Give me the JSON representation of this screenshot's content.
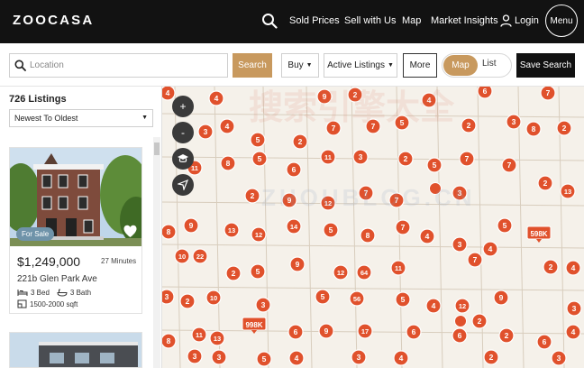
{
  "brand": {
    "logo": "ZOOCASA"
  },
  "nav": {
    "links": [
      "Sold Prices",
      "Sell with Us",
      "Map",
      "Market Insights"
    ],
    "login": "Login",
    "menu": "Menu"
  },
  "filters": {
    "location_placeholder": "Location",
    "search_label": "Search",
    "buy_label": "Buy",
    "status_label": "Active Listings",
    "more_label": "More",
    "map_label": "Map",
    "list_label": "List",
    "save_search_label": "Save Search"
  },
  "listings": {
    "count": "726 Listings",
    "sort": "Newest To Oldest",
    "card": {
      "badge": "For Sale",
      "price": "$1,249,000",
      "time": "27 Minutes",
      "address": "221b Glen Park Ave",
      "beds": "3 Bed",
      "baths": "3 Bath",
      "sqft": "1500-2000 sqft"
    }
  },
  "map": {
    "accent_color": "#e0512c",
    "grid_color": "#d8cdbd",
    "controls": [
      "zoom-in",
      "zoom-out",
      "school",
      "locate"
    ],
    "markers": [
      {
        "label": "4",
        "kind": "circle"
      },
      {
        "label": "4",
        "kind": "circle"
      },
      {
        "label": "9",
        "kind": "circle"
      },
      {
        "label": "2",
        "kind": "circle"
      },
      {
        "label": "4",
        "kind": "circle"
      },
      {
        "label": "6",
        "kind": "circle"
      },
      {
        "label": "7",
        "kind": "circle"
      },
      {
        "label": "3",
        "kind": "circle"
      },
      {
        "label": "4",
        "kind": "circle"
      },
      {
        "label": "7",
        "kind": "circle"
      },
      {
        "label": "7",
        "kind": "circle"
      },
      {
        "label": "5",
        "kind": "circle"
      },
      {
        "label": "2",
        "kind": "circle"
      },
      {
        "label": "3",
        "kind": "circle"
      },
      {
        "label": "8",
        "kind": "circle"
      },
      {
        "label": "2",
        "kind": "circle"
      },
      {
        "label": "5",
        "kind": "circle"
      },
      {
        "label": "2",
        "kind": "circle"
      },
      {
        "label": "11",
        "kind": "circle"
      },
      {
        "label": "3",
        "kind": "circle"
      },
      {
        "label": "2",
        "kind": "circle"
      },
      {
        "label": "11",
        "kind": "circle"
      },
      {
        "label": "8",
        "kind": "circle"
      },
      {
        "label": "6",
        "kind": "circle"
      },
      {
        "label": "5",
        "kind": "circle"
      },
      {
        "label": "7",
        "kind": "circle"
      },
      {
        "label": "7",
        "kind": "circle"
      },
      {
        "label": "5",
        "kind": "circle"
      },
      {
        "label": "2",
        "kind": "circle"
      },
      {
        "label": "9",
        "kind": "circle"
      },
      {
        "label": "12",
        "kind": "circle"
      },
      {
        "label": "7",
        "kind": "circle"
      },
      {
        "label": "7",
        "kind": "circle"
      },
      {
        "label": "",
        "kind": "dot"
      },
      {
        "label": "3",
        "kind": "circle"
      },
      {
        "label": "2",
        "kind": "circle"
      },
      {
        "label": "13",
        "kind": "circle"
      },
      {
        "label": "8",
        "kind": "circle"
      },
      {
        "label": "9",
        "kind": "circle"
      },
      {
        "label": "13",
        "kind": "circle"
      },
      {
        "label": "12",
        "kind": "circle"
      },
      {
        "label": "14",
        "kind": "circle"
      },
      {
        "label": "5",
        "kind": "circle"
      },
      {
        "label": "8",
        "kind": "circle"
      },
      {
        "label": "7",
        "kind": "circle"
      },
      {
        "label": "4",
        "kind": "circle"
      },
      {
        "label": "5",
        "kind": "circle"
      },
      {
        "label": "598K",
        "kind": "tag"
      },
      {
        "label": "10",
        "kind": "circle"
      },
      {
        "label": "22",
        "kind": "circle"
      },
      {
        "label": "4",
        "kind": "circle"
      },
      {
        "label": "3",
        "kind": "circle"
      },
      {
        "label": "7",
        "kind": "circle"
      },
      {
        "label": "2",
        "kind": "circle"
      },
      {
        "label": "4",
        "kind": "circle"
      },
      {
        "label": "2",
        "kind": "circle"
      },
      {
        "label": "5",
        "kind": "circle"
      },
      {
        "label": "9",
        "kind": "circle"
      },
      {
        "label": "12",
        "kind": "circle"
      },
      {
        "label": "64",
        "kind": "circle"
      },
      {
        "label": "11",
        "kind": "circle"
      },
      {
        "label": "3",
        "kind": "circle"
      },
      {
        "label": "2",
        "kind": "circle"
      },
      {
        "label": "10",
        "kind": "circle"
      },
      {
        "label": "3",
        "kind": "circle"
      },
      {
        "label": "5",
        "kind": "circle"
      },
      {
        "label": "56",
        "kind": "circle"
      },
      {
        "label": "5",
        "kind": "circle"
      },
      {
        "label": "4",
        "kind": "circle"
      },
      {
        "label": "12",
        "kind": "circle"
      },
      {
        "label": "9",
        "kind": "circle"
      },
      {
        "label": "3",
        "kind": "circle"
      },
      {
        "label": "998K",
        "kind": "tag"
      },
      {
        "label": "2",
        "kind": "circle"
      },
      {
        "label": "",
        "kind": "dot"
      },
      {
        "label": "8",
        "kind": "circle"
      },
      {
        "label": "11",
        "kind": "circle"
      },
      {
        "label": "13",
        "kind": "circle"
      },
      {
        "label": "6",
        "kind": "circle"
      },
      {
        "label": "9",
        "kind": "circle"
      },
      {
        "label": "17",
        "kind": "circle"
      },
      {
        "label": "6",
        "kind": "circle"
      },
      {
        "label": "6",
        "kind": "circle"
      },
      {
        "label": "2",
        "kind": "circle"
      },
      {
        "label": "6",
        "kind": "circle"
      },
      {
        "label": "4",
        "kind": "circle"
      },
      {
        "label": "3",
        "kind": "circle"
      },
      {
        "label": "3",
        "kind": "circle"
      },
      {
        "label": "5",
        "kind": "circle"
      },
      {
        "label": "4",
        "kind": "circle"
      },
      {
        "label": "3",
        "kind": "circle"
      },
      {
        "label": "4",
        "kind": "circle"
      },
      {
        "label": "2",
        "kind": "circle"
      },
      {
        "label": "3",
        "kind": "circle"
      }
    ]
  }
}
